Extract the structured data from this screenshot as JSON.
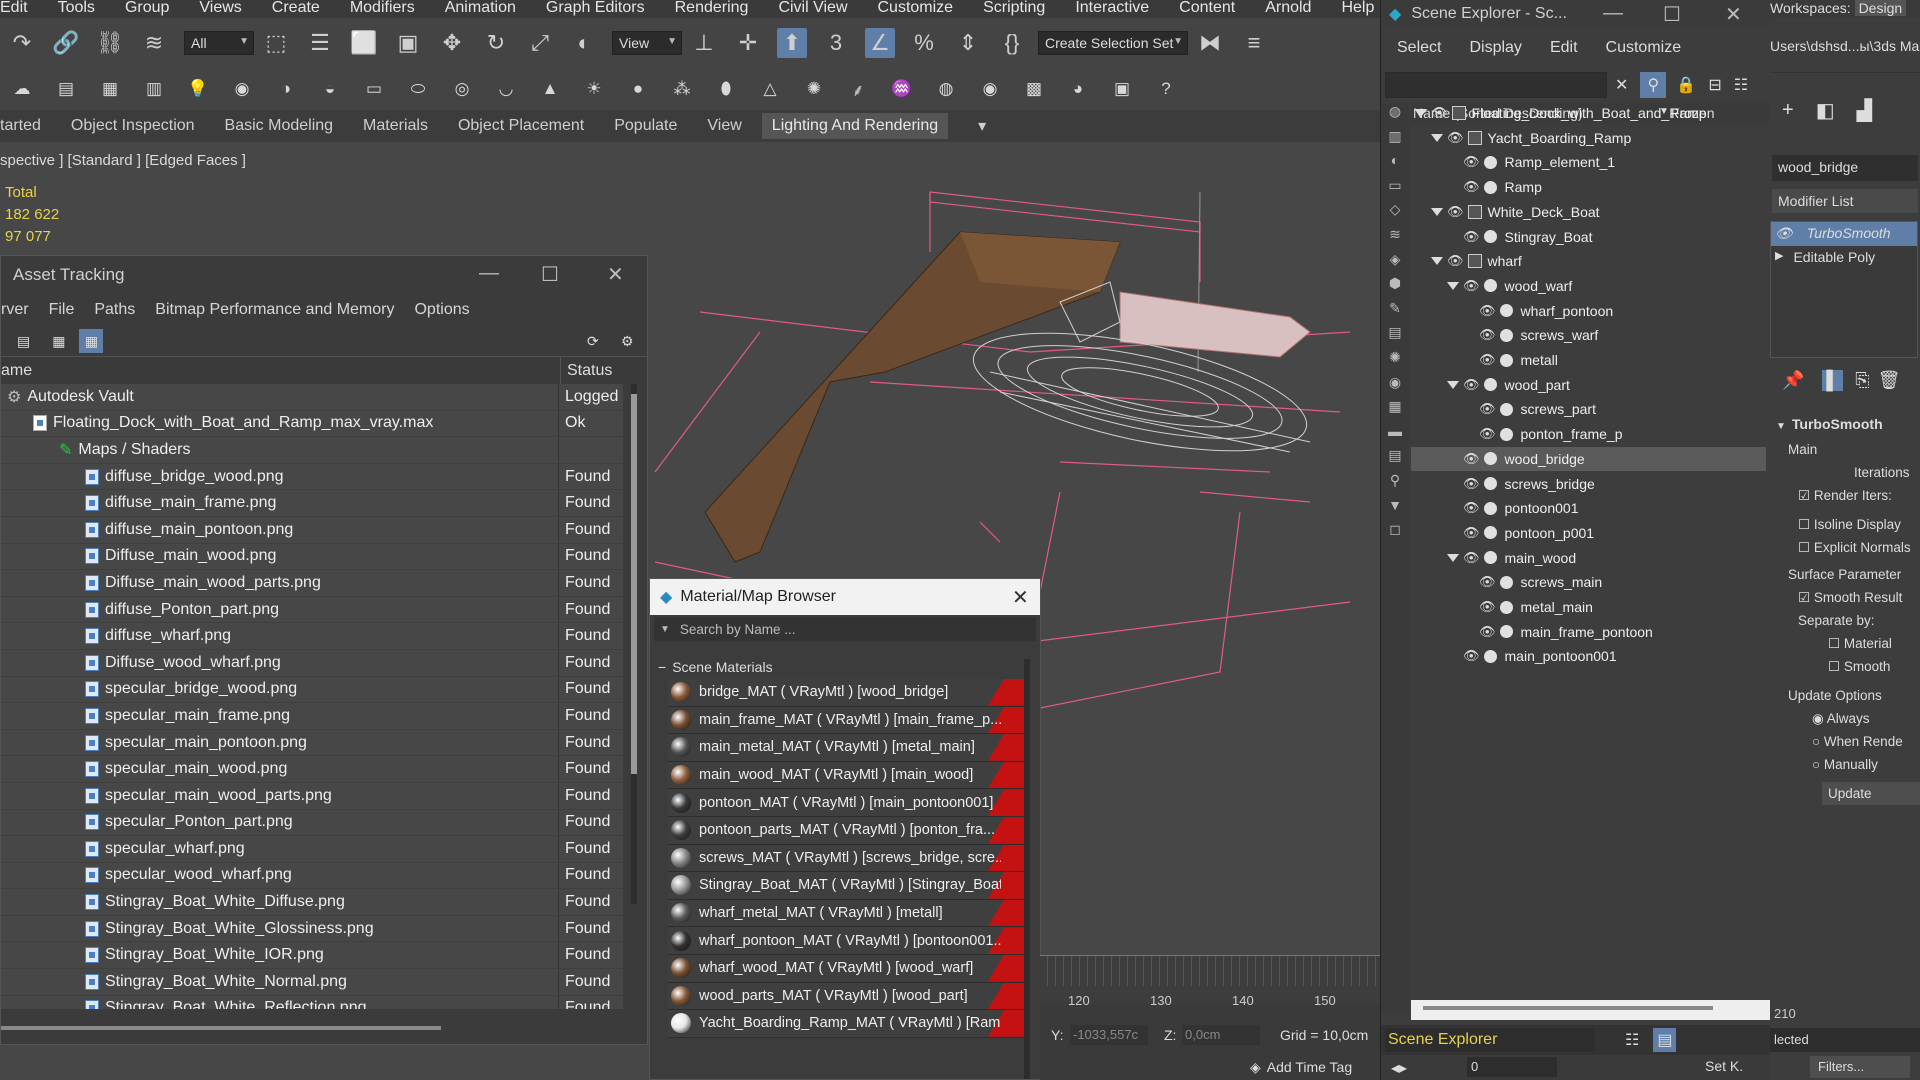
{
  "menubar": {
    "items": [
      "Edit",
      "Tools",
      "Group",
      "Views",
      "Create",
      "Modifiers",
      "Animation",
      "Graph Editors",
      "Rendering",
      "Civil View",
      "Customize",
      "Scripting",
      "Interactive",
      "Content",
      "Arnold",
      "Help"
    ]
  },
  "toolbar": {
    "filter_value": "All",
    "ref_coord": "View",
    "selection_set_placeholder": "Create Selection Set"
  },
  "ribbon": {
    "tabs": [
      "tarted",
      "Object Inspection",
      "Basic Modeling",
      "Materials",
      "Object Placement",
      "Populate",
      "View",
      "Lighting And Rendering"
    ],
    "active": "Lighting And Rendering"
  },
  "viewport": {
    "label": "spective ] [Standard ] [Edged Faces ]",
    "stats_title": "Total",
    "stats_values": [
      "182 622",
      "97 077"
    ]
  },
  "asset_tracking": {
    "title": "Asset Tracking",
    "menu": [
      "rver",
      "File",
      "Paths",
      "Bitmap Performance and Memory",
      "Options"
    ],
    "columns": [
      "ame",
      "Status"
    ],
    "rows": [
      {
        "name": "Autodesk Vault",
        "status": "Logged",
        "indent": 0,
        "kind": "vault"
      },
      {
        "name": "Floating_Dock_with_Boat_and_Ramp_max_vray.max",
        "status": "Ok",
        "indent": 1,
        "kind": "file"
      },
      {
        "name": "Maps / Shaders",
        "status": "",
        "indent": 2,
        "kind": "maps"
      },
      {
        "name": "diffuse_bridge_wood.png",
        "status": "Found",
        "indent": 3,
        "kind": "img"
      },
      {
        "name": "diffuse_main_frame.png",
        "status": "Found",
        "indent": 3,
        "kind": "img"
      },
      {
        "name": "diffuse_main_pontoon.png",
        "status": "Found",
        "indent": 3,
        "kind": "img"
      },
      {
        "name": "Diffuse_main_wood.png",
        "status": "Found",
        "indent": 3,
        "kind": "img"
      },
      {
        "name": "Diffuse_main_wood_parts.png",
        "status": "Found",
        "indent": 3,
        "kind": "img"
      },
      {
        "name": "diffuse_Ponton_part.png",
        "status": "Found",
        "indent": 3,
        "kind": "img"
      },
      {
        "name": "diffuse_wharf.png",
        "status": "Found",
        "indent": 3,
        "kind": "img"
      },
      {
        "name": "Diffuse_wood_wharf.png",
        "status": "Found",
        "indent": 3,
        "kind": "img"
      },
      {
        "name": "specular_bridge_wood.png",
        "status": "Found",
        "indent": 3,
        "kind": "img"
      },
      {
        "name": "specular_main_frame.png",
        "status": "Found",
        "indent": 3,
        "kind": "img"
      },
      {
        "name": "specular_main_pontoon.png",
        "status": "Found",
        "indent": 3,
        "kind": "img"
      },
      {
        "name": "specular_main_wood.png",
        "status": "Found",
        "indent": 3,
        "kind": "img"
      },
      {
        "name": "specular_main_wood_parts.png",
        "status": "Found",
        "indent": 3,
        "kind": "img"
      },
      {
        "name": "specular_Ponton_part.png",
        "status": "Found",
        "indent": 3,
        "kind": "img"
      },
      {
        "name": "specular_wharf.png",
        "status": "Found",
        "indent": 3,
        "kind": "img"
      },
      {
        "name": "specular_wood_wharf.png",
        "status": "Found",
        "indent": 3,
        "kind": "img"
      },
      {
        "name": "Stingray_Boat_White_Diffuse.png",
        "status": "Found",
        "indent": 3,
        "kind": "img"
      },
      {
        "name": "Stingray_Boat_White_Glossiness.png",
        "status": "Found",
        "indent": 3,
        "kind": "img"
      },
      {
        "name": "Stingray_Boat_White_IOR.png",
        "status": "Found",
        "indent": 3,
        "kind": "img"
      },
      {
        "name": "Stingray_Boat_White_Normal.png",
        "status": "Found",
        "indent": 3,
        "kind": "img"
      },
      {
        "name": "Stingray_Boat_White_Reflection.png",
        "status": "Found",
        "indent": 3,
        "kind": "img"
      }
    ]
  },
  "material_browser": {
    "title": "Material/Map Browser",
    "search_placeholder": "Search by Name ...",
    "section": "Scene Materials",
    "materials": [
      {
        "label": "bridge_MAT  ( VRayMtl )  [wood_bridge]",
        "ball": "#8a5a3a"
      },
      {
        "label": "main_frame_MAT  ( VRayMtl )  [main_frame_p...",
        "ball": "#7a5036"
      },
      {
        "label": "main_metal_MAT  ( VRayMtl )  [metal_main]",
        "ball": "#555555"
      },
      {
        "label": "main_wood_MAT  ( VRayMtl )  [main_wood]",
        "ball": "#8f6040"
      },
      {
        "label": "pontoon_MAT  ( VRayMtl )  [main_pontoon001]",
        "ball": "#3a3a3a"
      },
      {
        "label": "pontoon_parts_MAT  ( VRayMtl )  [ponton_fra...",
        "ball": "#3e3e3e"
      },
      {
        "label": "screws_MAT  ( VRayMtl )  [screws_bridge, scre...",
        "ball": "#888888"
      },
      {
        "label": "Stingray_Boat_MAT  ( VRayMtl )  [Stingray_Boat]",
        "ball": "#9a9a9a"
      },
      {
        "label": "wharf_metal_MAT  ( VRayMtl )  [metall]",
        "ball": "#5c5c5c"
      },
      {
        "label": "wharf_pontoon_MAT  ( VRayMtl )  [pontoon001...",
        "ball": "#333333"
      },
      {
        "label": "wharf_wood_MAT  ( VRayMtl )  [wood_warf]",
        "ball": "#7c5234"
      },
      {
        "label": "wood_parts_MAT  ( VRayMtl )  [wood_part]",
        "ball": "#845838"
      },
      {
        "label": "Yacht_Boarding_Ramp_MAT  ( VRayMtl )  [Ram...",
        "ball": "#e8e8e8"
      }
    ]
  },
  "scene_explorer": {
    "title": "Scene Explorer - Sc...",
    "menu": [
      "Select",
      "Display",
      "Edit",
      "Customize"
    ],
    "col_name": "Name (Sorted Descending)",
    "col_frozen": "Frozen",
    "bottom_label": "Scene Explorer",
    "tree": [
      {
        "name": "Floating_Dock_with_Boat_and_Ramp",
        "level": 0,
        "group": true,
        "open": true
      },
      {
        "name": "Yacht_Boarding_Ramp",
        "level": 1,
        "group": true,
        "open": true
      },
      {
        "name": "Ramp_element_1",
        "level": 2,
        "group": false
      },
      {
        "name": "Ramp",
        "level": 2,
        "group": false
      },
      {
        "name": "White_Deck_Boat",
        "level": 1,
        "group": true,
        "open": true
      },
      {
        "name": "Stingray_Boat",
        "level": 2,
        "group": false
      },
      {
        "name": "wharf",
        "level": 1,
        "group": true,
        "open": true
      },
      {
        "name": "wood_warf",
        "level": 2,
        "group": false,
        "open": true
      },
      {
        "name": "wharf_pontoon",
        "level": 3,
        "group": false
      },
      {
        "name": "screws_warf",
        "level": 3,
        "group": false
      },
      {
        "name": "metall",
        "level": 3,
        "group": false
      },
      {
        "name": "wood_part",
        "level": 2,
        "group": false,
        "open": true
      },
      {
        "name": "screws_part",
        "level": 3,
        "group": false
      },
      {
        "name": "ponton_frame_p",
        "level": 3,
        "group": false
      },
      {
        "name": "wood_bridge",
        "level": 2,
        "group": false,
        "selected": true
      },
      {
        "name": "screws_bridge",
        "level": 2,
        "group": false
      },
      {
        "name": "pontoon001",
        "level": 2,
        "group": false
      },
      {
        "name": "pontoon_p001",
        "level": 2,
        "group": false
      },
      {
        "name": "main_wood",
        "level": 2,
        "group": false,
        "open": true
      },
      {
        "name": "screws_main",
        "level": 3,
        "group": false
      },
      {
        "name": "metal_main",
        "level": 3,
        "group": false
      },
      {
        "name": "main_frame_pontoon",
        "level": 3,
        "group": false
      },
      {
        "name": "main_pontoon001",
        "level": 2,
        "group": false
      }
    ]
  },
  "command_panel": {
    "workspace_label": "Workspaces:",
    "workspace_value": "Design",
    "path": "Users\\dshsd...ы\\3ds Ma",
    "object_name": "wood_bridge",
    "modifier_list": "Modifier List",
    "stack": [
      "TurboSmooth",
      "Editable Poly"
    ],
    "rollout_title": "TurboSmooth",
    "main_label": "Main",
    "iterations_label": "Iterations",
    "render_iters_label": "Render Iters:",
    "isoline_label": "Isoline Display",
    "explicit_label": "Explicit Normals",
    "surface_label": "Surface Parameter",
    "smooth_result_label": "Smooth Result",
    "separate_label": "Separate by:",
    "material_label": "Material",
    "smooth_label": "Smooth",
    "update_label": "Update Options",
    "always_label": "Always",
    "when_render_label": "When Rende",
    "manually_label": "Manually",
    "update_btn": "Update",
    "selected_dd": "lected",
    "filters_btn": "Filters...",
    "setk_btn": "Set K.",
    "spinner_value": "0"
  },
  "status": {
    "ticks": [
      "120",
      "130",
      "140",
      "150"
    ],
    "right_ticks": [
      "210"
    ],
    "y_label": "Y:",
    "y_value": "-1033,557c",
    "z_label": "Z:",
    "z_value": "0,0cm",
    "grid_text": "Grid = 10,0cm",
    "add_time_tag": "Add Time Tag"
  }
}
